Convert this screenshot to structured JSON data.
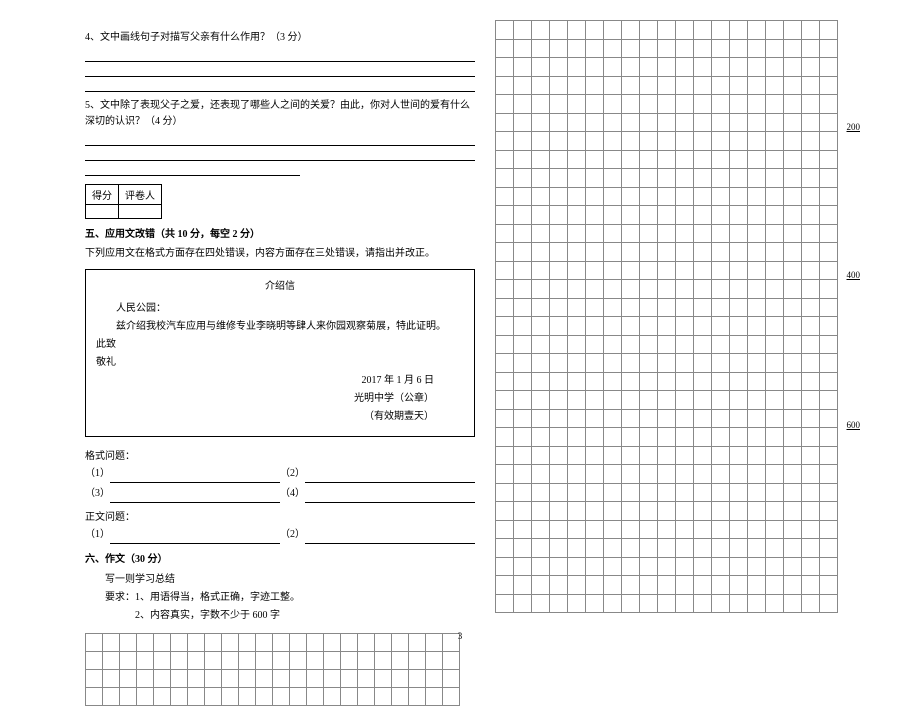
{
  "left": {
    "q4": "4、文中画线句子对描写父亲有什么作用？（3 分）",
    "q5": "5、文中除了表现父子之爱，还表现了哪些人之间的关爱？由此，你对人世间的爱有什么深切的认识？（4 分）",
    "scoreTable": {
      "score": "得分",
      "marker": "评卷人"
    },
    "section5": "五、应用文改错（共 10 分，每空 2 分）",
    "section5Instr": "下列应用文在格式方面存在四处错误，内容方面存在三处错误，请指出并改正。",
    "letter": {
      "title": "介绍信",
      "addressee": "人民公园：",
      "body": "兹介绍我校汽车应用与维修专业李晓明等肆人来你园观察菊展，特此证明。",
      "closing1": "此致",
      "closing2": "敬礼",
      "date": "2017 年 1 月 6 日",
      "sender": "光明中学（公章）",
      "valid": "（有效期壹天）"
    },
    "formatLabel": "格式问题：",
    "contentLabel": "正文问题：",
    "num1": "（1）",
    "num2": "（2）",
    "num3": "（3）",
    "num4": "（4）",
    "section6": "六、作文（30 分）",
    "essayPrompt": "写一则学习总结",
    "essayReqLabel": "要求：",
    "essayReq1": "1、用语得当，格式正确，字迹工整。",
    "essayReq2": "2、内容真实，字数不少于 600 字"
  },
  "markers": {
    "m200": "200",
    "m400": "400",
    "m600": "600"
  },
  "pageNum": "3"
}
